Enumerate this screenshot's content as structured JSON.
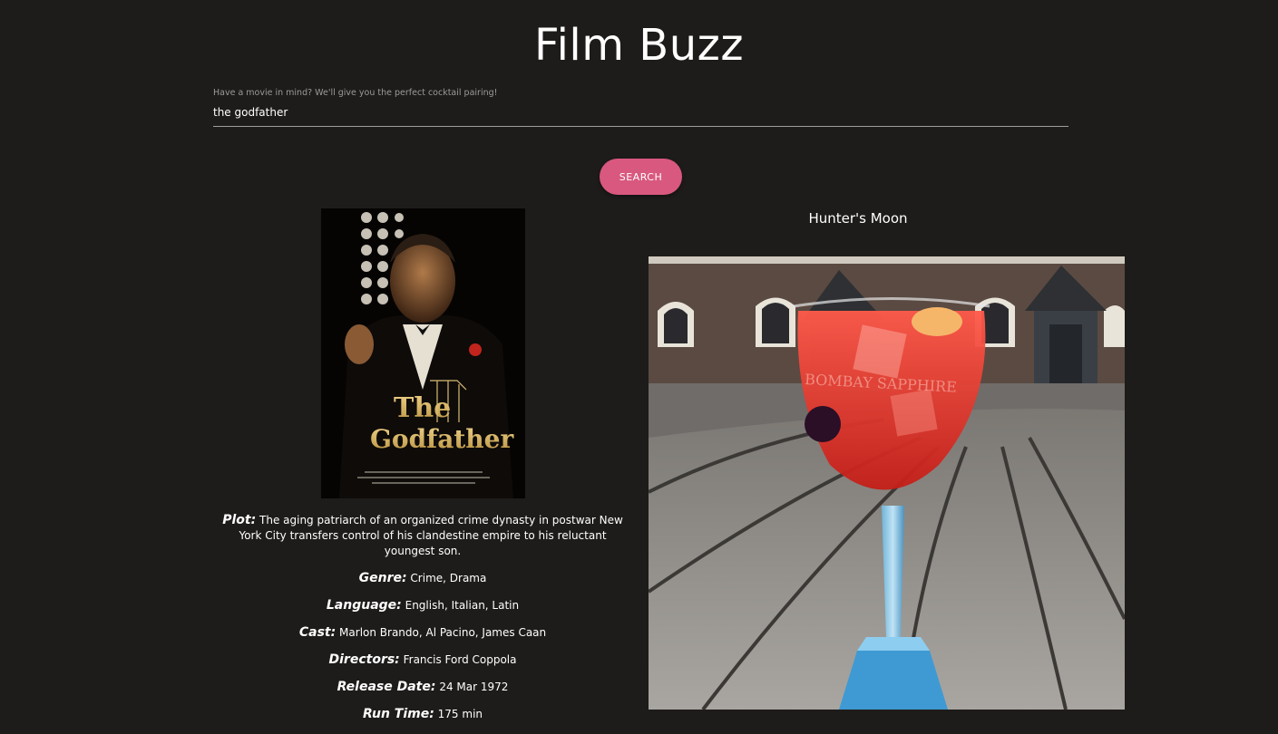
{
  "app": {
    "title": "Film Buzz"
  },
  "search": {
    "label": "Have a movie in mind? We'll give you the perfect cocktail pairing!",
    "value": "the godfather",
    "button_label": "SEARCH"
  },
  "movie": {
    "poster_title_line1": "The",
    "poster_title_line2": "Godfather",
    "plot_label": "Plot:",
    "plot": "The aging patriarch of an organized crime dynasty in postwar New York City transfers control of his clandestine empire to his reluctant youngest son.",
    "genre_label": "Genre:",
    "genre": "Crime, Drama",
    "language_label": "Language:",
    "language": "English, Italian, Latin",
    "cast_label": "Cast:",
    "cast": "Marlon Brando, Al Pacino, James Caan",
    "directors_label": "Directors:",
    "directors": "Francis Ford Coppola",
    "release_label": "Release Date:",
    "release": "24 Mar 1972",
    "runtime_label": "Run Time:",
    "runtime": "175 min"
  },
  "cocktail": {
    "name": "Hunter's Moon",
    "glass_text": "BOMBAY SAPPHIRE"
  },
  "colors": {
    "background": "#1e1c1b",
    "accent": "#d9587f",
    "text": "#ffffff",
    "muted": "#9a9a9a"
  }
}
